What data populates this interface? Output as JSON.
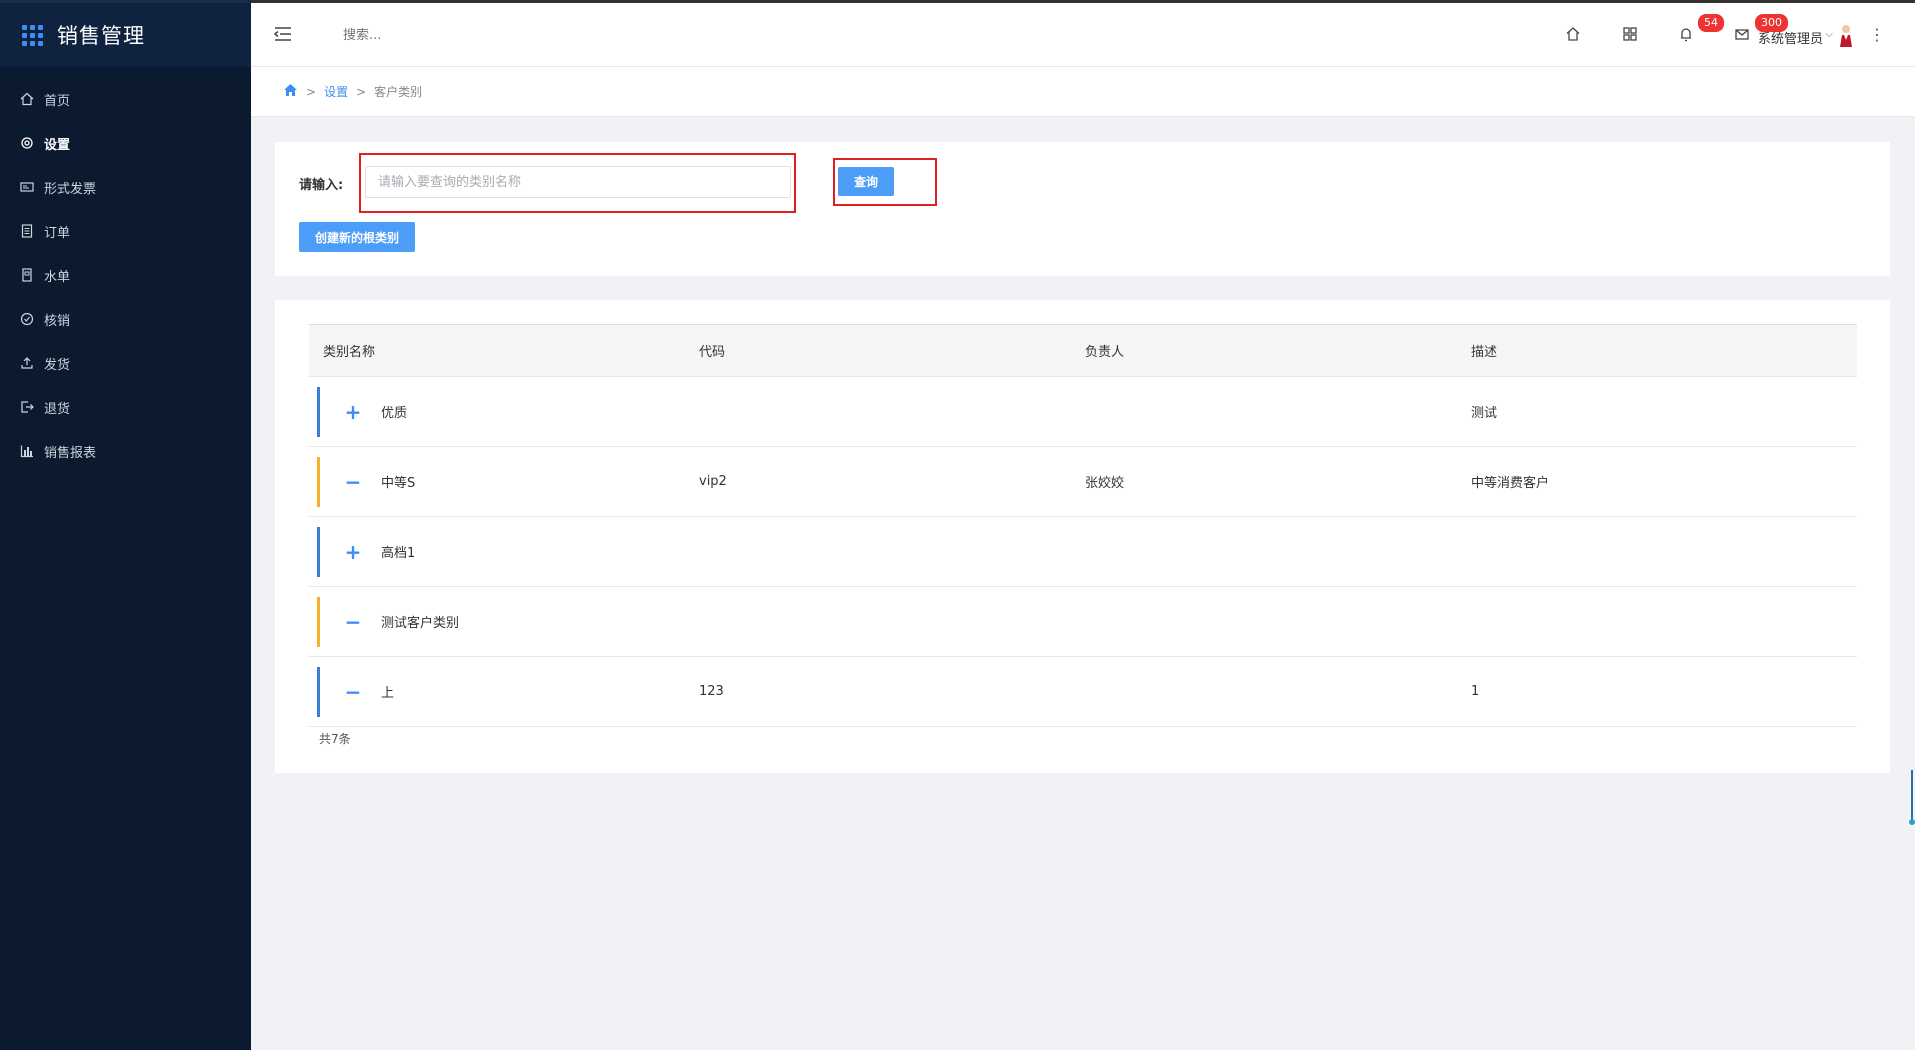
{
  "app": {
    "title": "销售管理"
  },
  "sidebar": {
    "items": [
      {
        "label": "首页",
        "icon": "home-icon",
        "active": false
      },
      {
        "label": "设置",
        "icon": "gear-icon",
        "active": true
      },
      {
        "label": "形式发票",
        "icon": "invoice-icon",
        "active": false
      },
      {
        "label": "订单",
        "icon": "order-icon",
        "active": false
      },
      {
        "label": "水单",
        "icon": "receipt-icon",
        "active": false
      },
      {
        "label": "核销",
        "icon": "check-circle-icon",
        "active": false
      },
      {
        "label": "发货",
        "icon": "upload-icon",
        "active": false
      },
      {
        "label": "退货",
        "icon": "return-icon",
        "active": false
      },
      {
        "label": "销售报表",
        "icon": "bar-chart-icon",
        "active": false
      }
    ]
  },
  "header": {
    "search_placeholder": "搜索...",
    "notifications_count": "54",
    "messages_count": "300",
    "user_name": "系统管理员"
  },
  "breadcrumb": {
    "settings": "设置",
    "current": "客户类别",
    "sep": ">"
  },
  "search": {
    "label": "请输入:",
    "placeholder": "请输入要查询的类别名称",
    "value": "",
    "query_button": "查询",
    "create_button": "创建新的根类别"
  },
  "table": {
    "headers": [
      "类别名称",
      "代码",
      "负责人",
      "描述"
    ],
    "rows": [
      {
        "toggle": "+",
        "name": "优质",
        "code": "",
        "owner": "",
        "desc": "测试",
        "bar_color": "#3c7fd1"
      },
      {
        "toggle": "−",
        "name": "中等S",
        "code": "vip2",
        "owner": "张姣姣",
        "desc": "中等消费客户",
        "bar_color": "#f5b02e"
      },
      {
        "toggle": "+",
        "name": "高档1",
        "code": "",
        "owner": "",
        "desc": "",
        "bar_color": "#3c7fd1"
      },
      {
        "toggle": "−",
        "name": "测试客户类别",
        "code": "",
        "owner": "",
        "desc": "",
        "bar_color": "#f5b02e"
      },
      {
        "toggle": "−",
        "name": "上",
        "code": "123",
        "owner": "",
        "desc": "1",
        "bar_color": "#3c7fd1"
      }
    ],
    "total": "共7条"
  },
  "colors": {
    "accent": "#4b9df7",
    "sidebar_bg": "#0b1a2f",
    "highlight": "#e02020"
  }
}
